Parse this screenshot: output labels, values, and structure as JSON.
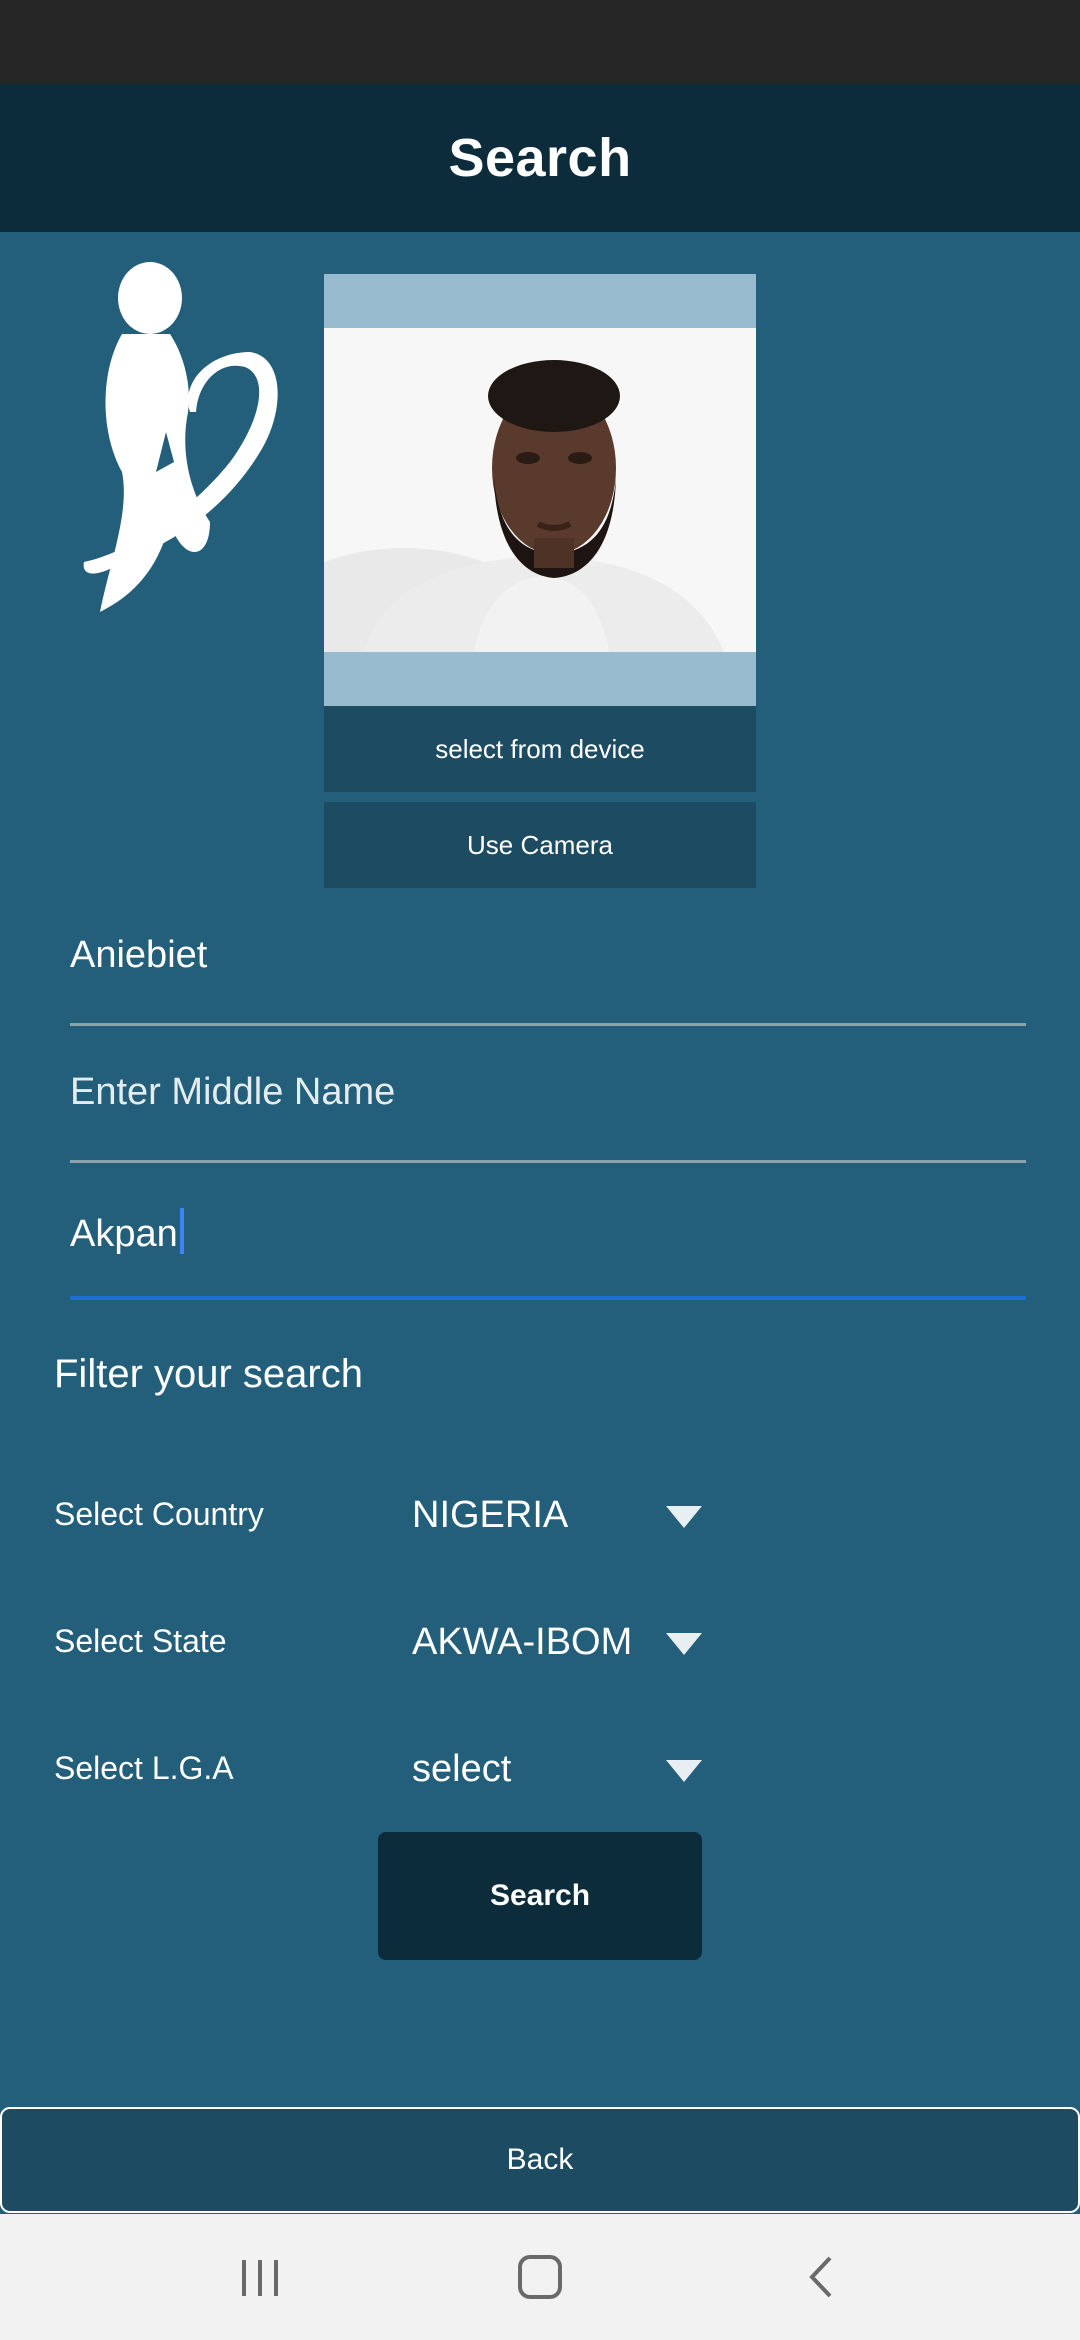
{
  "header": {
    "title": "Search"
  },
  "image_panel": {
    "select_label": "select from device",
    "camera_label": "Use Camera"
  },
  "form": {
    "first_name": {
      "value": "Aniebiet"
    },
    "middle_name": {
      "placeholder": "Enter Middle Name"
    },
    "last_name": {
      "value": "Akpan"
    }
  },
  "filter": {
    "title": "Filter your search",
    "country": {
      "label": "Select Country",
      "value": "NIGERIA"
    },
    "state": {
      "label": "Select State",
      "value": "AKWA-IBOM"
    },
    "lga": {
      "label": "Select L.G.A",
      "value": "select"
    }
  },
  "actions": {
    "search_label": "Search",
    "back_label": "Back"
  },
  "icons": {
    "logo": "heart-figure-logo-icon",
    "dropdown": "triangle-down-icon",
    "nav": [
      "recents-icon",
      "home-icon",
      "back-icon"
    ]
  },
  "colors": {
    "background": "#235f7a",
    "app_bar": "#0c2b3b",
    "button": "#1c4b62",
    "focus_accent": "#1c6fd6"
  }
}
